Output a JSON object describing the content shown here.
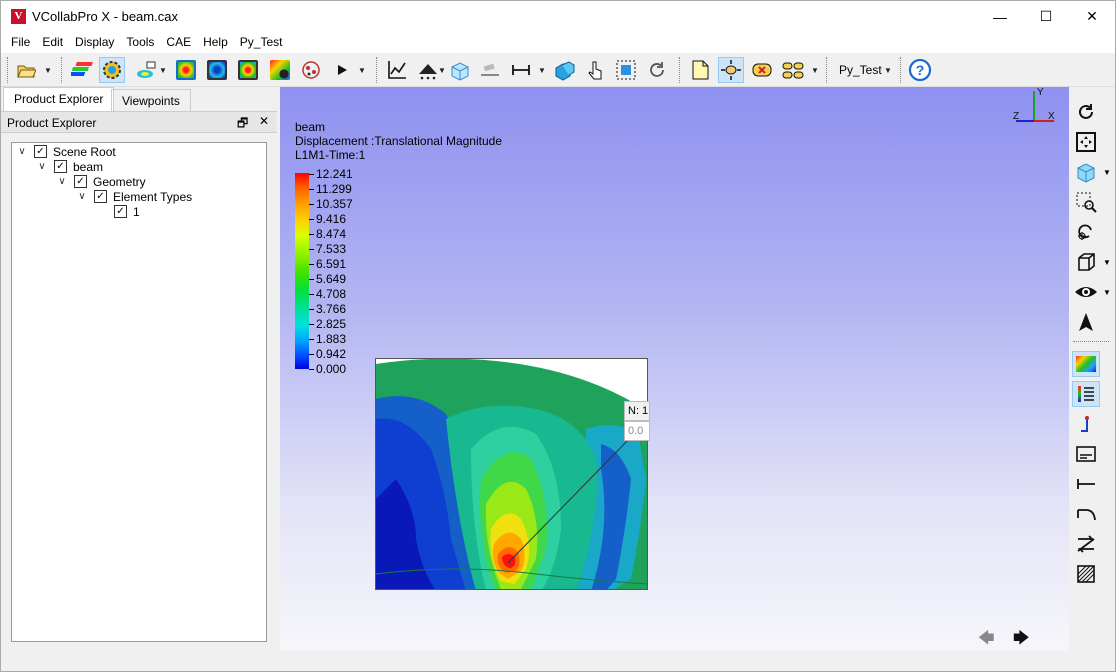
{
  "window": {
    "title": "VCollabPro X - beam.cax",
    "app_icon_letter": "V",
    "controls": {
      "minimize": "—",
      "maximize": "☐",
      "close": "✕"
    }
  },
  "menu": [
    "File",
    "Edit",
    "Display",
    "Tools",
    "CAE",
    "Help",
    "Py_Test"
  ],
  "toolbar": {
    "combo_label": "Py_Test",
    "icons": [
      "open-folder-icon",
      "layers-icon",
      "settings-icon",
      "probe-icon",
      "contour-icon",
      "fringe-icon",
      "isoline-icon",
      "animation-settings-icon",
      "markers-icon",
      "play-icon",
      "graph-icon",
      "vector-icon",
      "section-icon",
      "measure-icon",
      "distance-icon",
      "explode-icon",
      "pick-icon",
      "select-box-icon",
      "refresh-icon",
      "note-icon",
      "pan-icon",
      "delete-label-icon",
      "labels-icon",
      "help-icon"
    ]
  },
  "left_panel": {
    "tabs": [
      "Product Explorer",
      "Viewpoints"
    ],
    "active_tab": "Product Explorer",
    "header": "Product Explorer",
    "tree": [
      {
        "label": "Scene Root",
        "level": 0,
        "checked": true,
        "expanded": true
      },
      {
        "label": "beam",
        "level": 1,
        "checked": true,
        "expanded": true
      },
      {
        "label": "Geometry",
        "level": 2,
        "checked": true,
        "expanded": true
      },
      {
        "label": "Element Types",
        "level": 3,
        "checked": true,
        "expanded": true
      },
      {
        "label": "1",
        "level": 4,
        "checked": true,
        "expanded": false
      }
    ]
  },
  "viewport": {
    "model_name": "beam",
    "result_label": "Displacement :Translational Magnitude",
    "time_label": "L1M1-Time:1",
    "legend_values": [
      "12.241",
      "11.299",
      "10.357",
      "9.416",
      "8.474",
      "7.533",
      "6.591",
      "5.649",
      "4.708",
      "3.766",
      "2.825",
      "1.883",
      "0.942",
      "0.000"
    ],
    "probe": {
      "node": "N: 1",
      "value": "0.0"
    },
    "axes": {
      "x": "X",
      "y": "Y",
      "z": "Z"
    },
    "colors": {
      "accent": "#cce4f7",
      "legend_max": "#ff0000",
      "legend_min": "#0000e0"
    }
  },
  "right_toolbar": {
    "icons": [
      "rotate-icon",
      "fit-view-icon",
      "cube-view-icon",
      "zoom-box-icon",
      "rotate-point-icon",
      "wireframe-icon",
      "visibility-icon",
      "pointer-icon",
      "legend-color-icon",
      "legend-list-icon",
      "axis-marker-icon",
      "caption-icon",
      "dimension-icon",
      "arc-icon",
      "transform-icon",
      "hatch-icon"
    ]
  }
}
